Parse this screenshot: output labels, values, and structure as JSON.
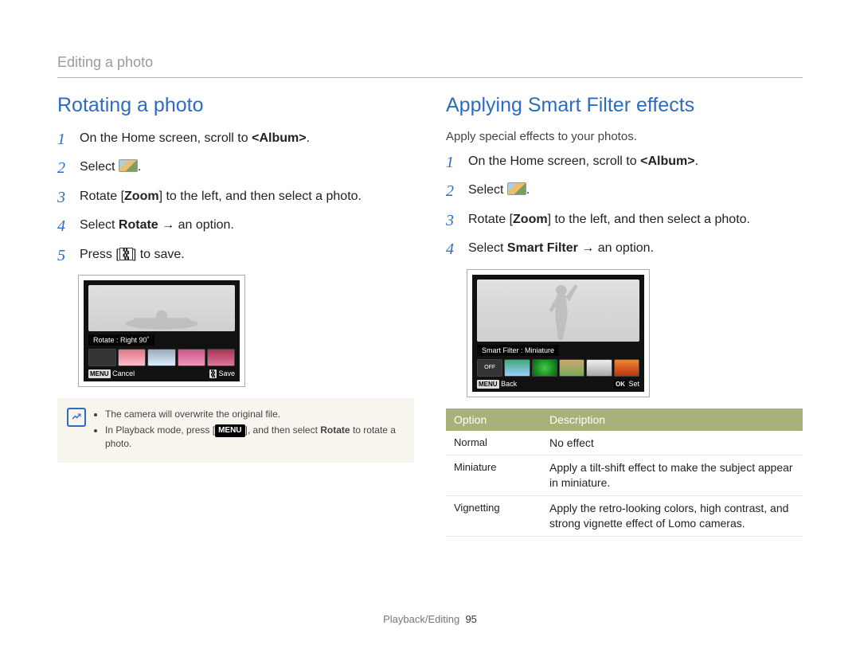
{
  "breadcrumb": "Editing a photo",
  "footer": {
    "section": "Playback/Editing",
    "page": "95"
  },
  "left": {
    "title": "Rotating a photo",
    "steps": [
      {
        "pre": "On the Home screen, scroll to ",
        "bold": "<Album>",
        "post": "."
      },
      {
        "pre": "Select ",
        "icon": true,
        "post": "."
      },
      {
        "pre": "Rotate [",
        "bold": "Zoom",
        "post": "] to the left, and then select a photo."
      },
      {
        "pre": "Select ",
        "bold": "Rotate",
        "post_arrow": " → an option."
      },
      {
        "pre": "Press [",
        "glyph": "🮕",
        "post": "] to save."
      }
    ],
    "camera": {
      "label": "Rotate : Right 90˚",
      "footer_left_btn": "MENU",
      "footer_left_text": "Cancel",
      "footer_right_btn": "🮕",
      "footer_right_text": "Save"
    },
    "note": {
      "items": [
        "The camera will overwrite the original file.",
        {
          "pre": "In Playback mode, press [",
          "menu": "MENU",
          "mid": "], and then select ",
          "bold": "Rotate",
          "post": " to rotate a photo."
        }
      ]
    }
  },
  "right": {
    "title": "Applying Smart Filter effects",
    "subtitle": "Apply special effects to your photos.",
    "steps": [
      {
        "pre": "On the Home screen, scroll to ",
        "bold": "<Album>",
        "post": "."
      },
      {
        "pre": "Select ",
        "icon": true,
        "post": "."
      },
      {
        "pre": "Rotate [",
        "bold": "Zoom",
        "post": "] to the left, and then select a photo."
      },
      {
        "pre": "Select ",
        "bold": "Smart Filter",
        "post_arrow": " → an option."
      }
    ],
    "camera": {
      "label": "Smart Filter : Miniature",
      "footer_left_btn": "MENU",
      "footer_left_text": "Back",
      "footer_right_btn": "OK",
      "footer_right_text": "Set"
    },
    "table": {
      "headers": [
        "Option",
        "Description"
      ],
      "rows": [
        {
          "option": "Normal",
          "desc": "No effect"
        },
        {
          "option": "Miniature",
          "desc": "Apply a tilt-shift effect to make the subject appear in miniature."
        },
        {
          "option": "Vignetting",
          "desc": "Apply the retro-looking colors, high contrast, and strong vignette effect of Lomo cameras."
        }
      ]
    }
  }
}
